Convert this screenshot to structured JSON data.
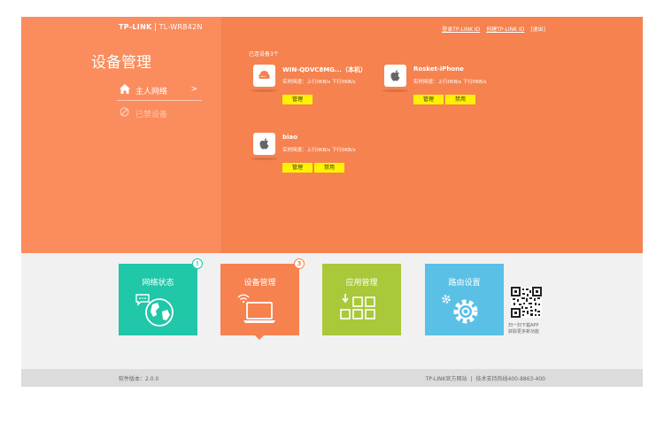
{
  "header": {
    "brand": "TP-LINK",
    "model": "TL-WR842N",
    "login_link": "登录TP-LINK ID",
    "create_link": "创建TP-LINK ID",
    "logout": "[退出]"
  },
  "sidebar": {
    "title": "设备管理",
    "items": [
      {
        "label": "主人网络",
        "chevron": ">",
        "icon": "home-icon"
      },
      {
        "label": "已禁设备",
        "icon": "ban-icon"
      }
    ]
  },
  "devices": {
    "count_label": "已连设备3个",
    "list": [
      {
        "name": "WIN-QDVC8MG...（本机）",
        "speed": "实时网速：上行0KB/s  下行0KB/s",
        "icon": "router-icon",
        "buttons": [
          "管理"
        ]
      },
      {
        "name": "Rosket-iPhone",
        "speed": "实时网速：上行0KB/s  下行0KB/s",
        "icon": "apple-icon",
        "buttons": [
          "管理",
          "禁用"
        ]
      },
      {
        "name": "biao",
        "speed": "实时网速：上行0KB/s  下行0KB/s",
        "icon": "apple-icon",
        "buttons": [
          "管理",
          "禁用"
        ]
      }
    ]
  },
  "tiles": [
    {
      "label": "网络状态",
      "badge": "!",
      "color": "#20c7a8",
      "icon": "globe-icon"
    },
    {
      "label": "设备管理",
      "badge": "3",
      "color": "#f5824f",
      "icon": "laptop-wifi-icon"
    },
    {
      "label": "应用管理",
      "badge": "",
      "color": "#a9c83a",
      "icon": "apps-grid-icon"
    },
    {
      "label": "路由设置",
      "badge": "",
      "color": "#5ac0e6",
      "icon": "gear-icon"
    }
  ],
  "app_promo": {
    "line1": "扫一扫下载APP",
    "line2": "获取更多新功能"
  },
  "footer": {
    "version": "软件版本：2.0.0",
    "site": "TP-LINK官方网站",
    "separator": "|",
    "support": "技术支持热线400-8863-400"
  }
}
